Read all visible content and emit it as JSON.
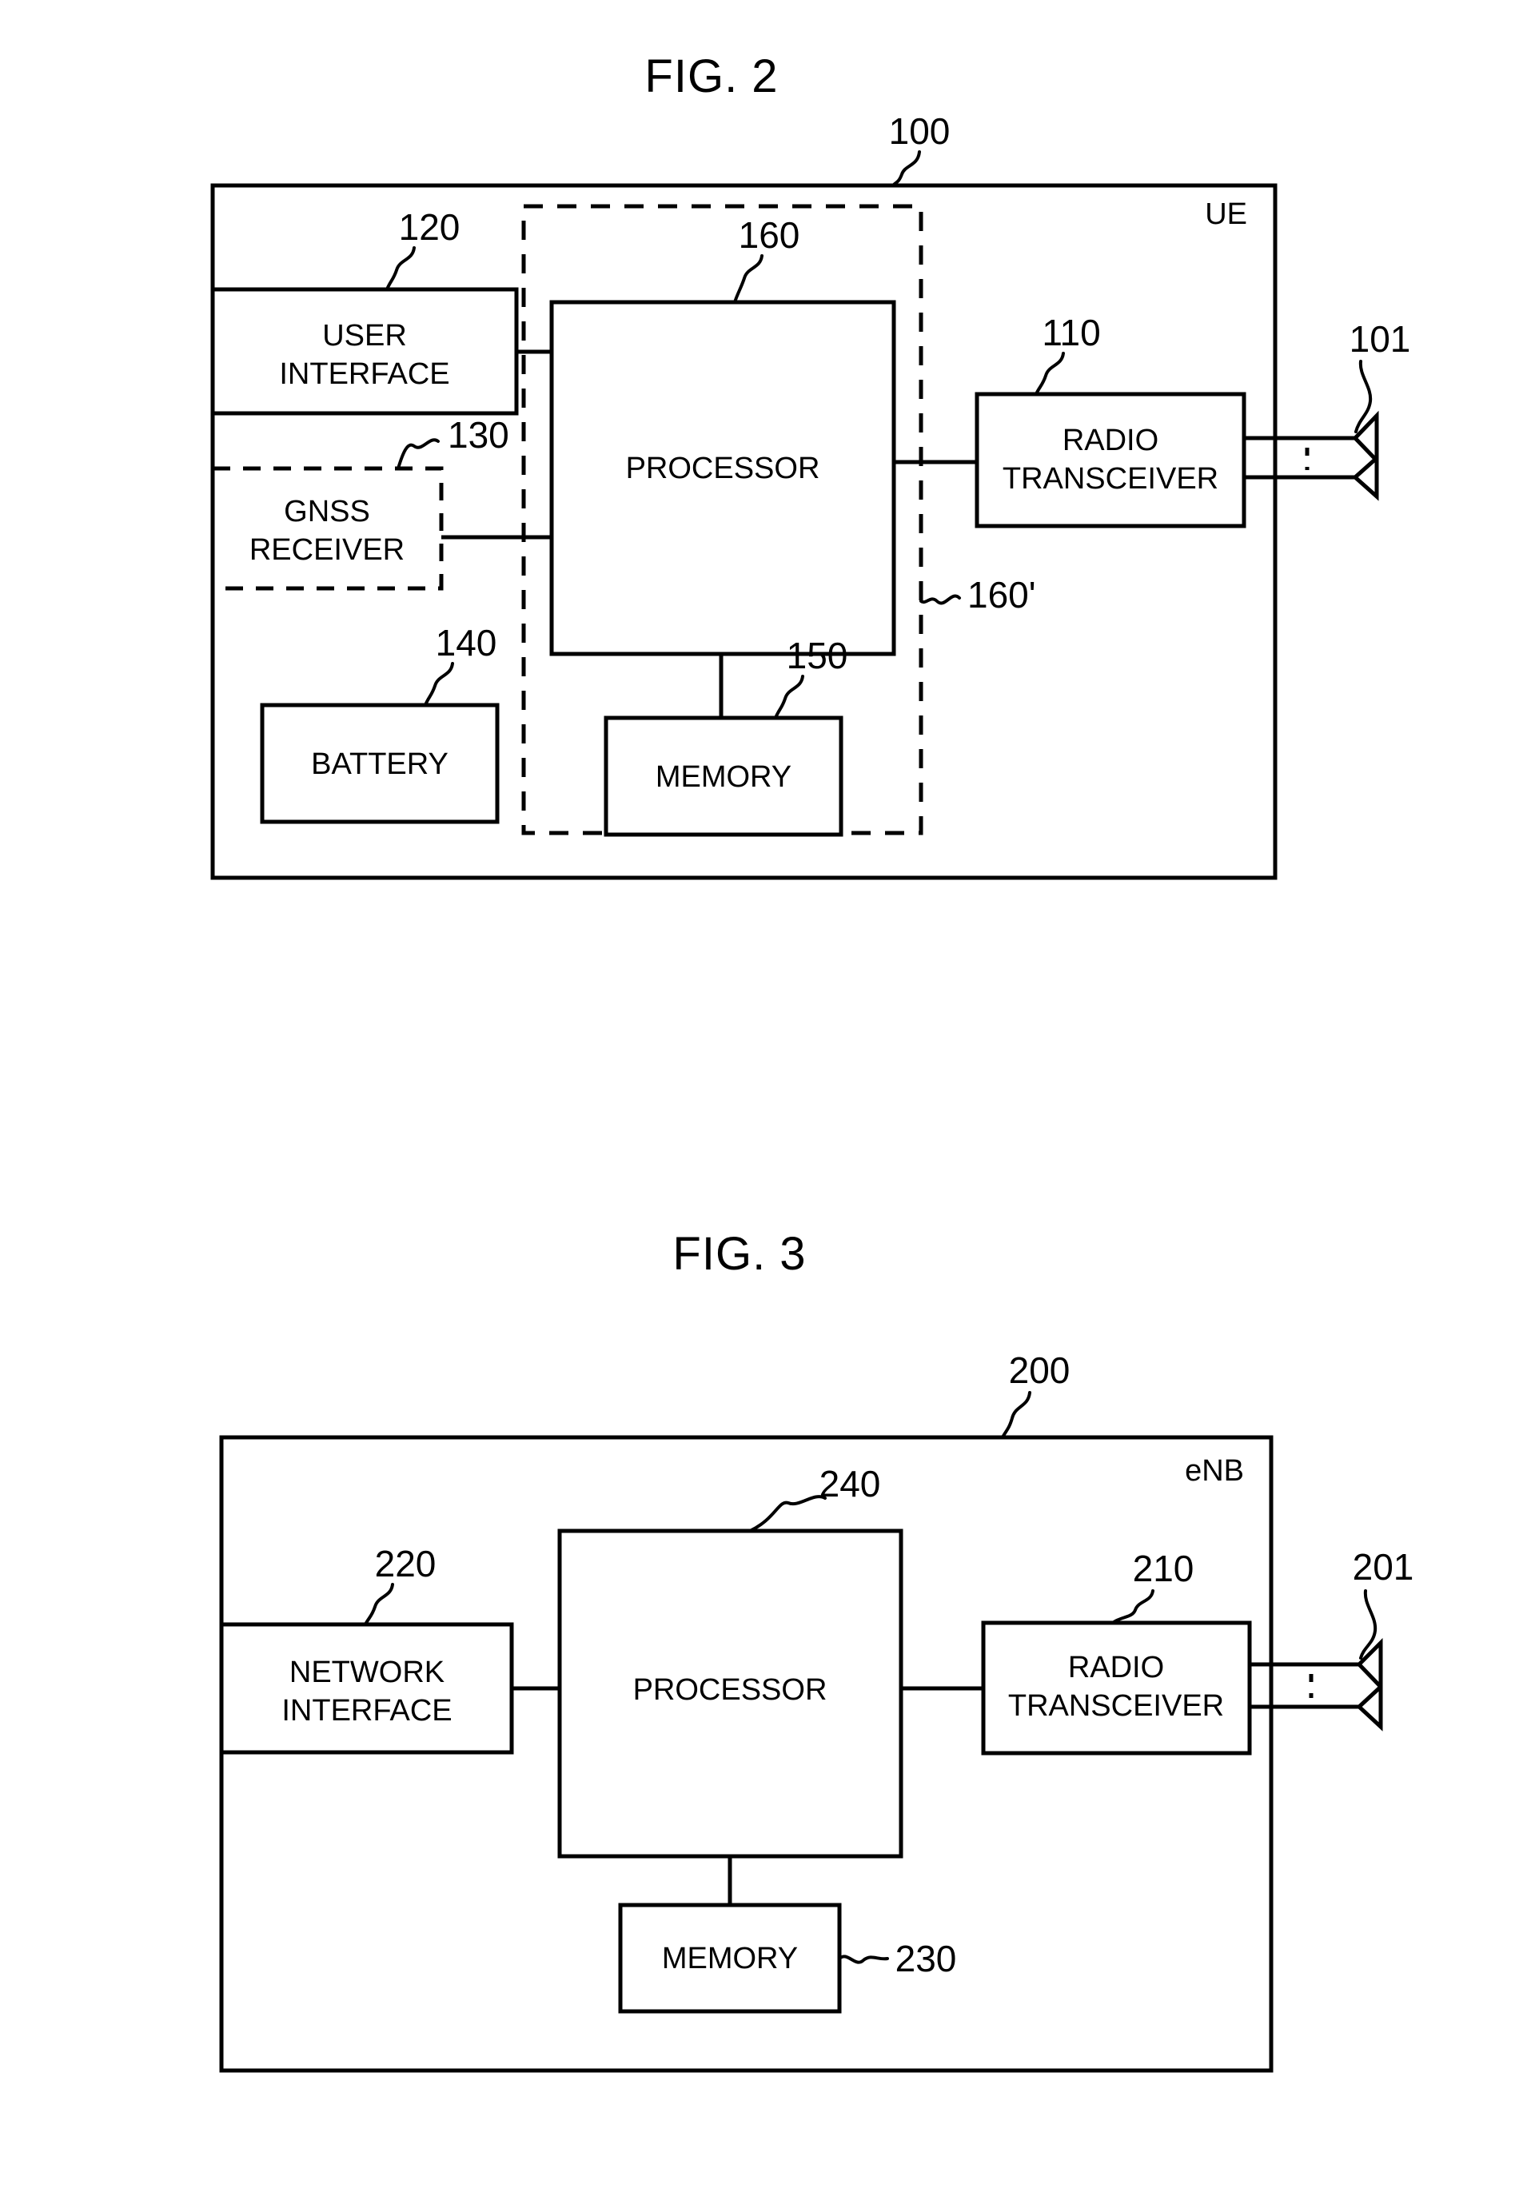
{
  "document": {
    "type": "patent-drawing-sheet",
    "figures": [
      {
        "id": "fig2",
        "title": "FIG. 2",
        "device_label": "UE",
        "device_ref": "100",
        "antenna_ref": "101",
        "dashed_group_ref": "160'",
        "blocks": [
          {
            "key": "user_interface",
            "label_line1": "USER",
            "label_line2": "INTERFACE",
            "ref": "120",
            "style": "solid"
          },
          {
            "key": "gnss_receiver",
            "label_line1": "GNSS",
            "label_line2": "RECEIVER",
            "ref": "130",
            "style": "dashed"
          },
          {
            "key": "battery",
            "label_line1": "BATTERY",
            "label_line2": "",
            "ref": "140",
            "style": "solid"
          },
          {
            "key": "processor",
            "label_line1": "PROCESSOR",
            "label_line2": "",
            "ref": "160",
            "style": "solid"
          },
          {
            "key": "memory",
            "label_line1": "MEMORY",
            "label_line2": "",
            "ref": "150",
            "style": "solid"
          },
          {
            "key": "radio_transceiver",
            "label_line1": "RADIO",
            "label_line2": "TRANSCEIVER",
            "ref": "110",
            "style": "solid"
          }
        ]
      },
      {
        "id": "fig3",
        "title": "FIG. 3",
        "device_label": "eNB",
        "device_ref": "200",
        "antenna_ref": "201",
        "blocks": [
          {
            "key": "network_interface",
            "label_line1": "NETWORK",
            "label_line2": "INTERFACE",
            "ref": "220",
            "style": "solid"
          },
          {
            "key": "processor",
            "label_line1": "PROCESSOR",
            "label_line2": "",
            "ref": "240",
            "style": "solid"
          },
          {
            "key": "memory",
            "label_line1": "MEMORY",
            "label_line2": "",
            "ref": "230",
            "style": "solid"
          },
          {
            "key": "radio_transceiver",
            "label_line1": "RADIO",
            "label_line2": "TRANSCEIVER",
            "ref": "210",
            "style": "solid"
          }
        ]
      }
    ]
  },
  "fig2": {
    "title": "FIG. 2",
    "ue_label": "UE",
    "ref_100": "100",
    "ref_101": "101",
    "ref_110": "110",
    "ref_120": "120",
    "ref_130": "130",
    "ref_140": "140",
    "ref_150": "150",
    "ref_160": "160",
    "ref_160p": "160'",
    "user_interface_l1": "USER",
    "user_interface_l2": "INTERFACE",
    "gnss_l1": "GNSS",
    "gnss_l2": "RECEIVER",
    "battery": "BATTERY",
    "processor": "PROCESSOR",
    "memory": "MEMORY",
    "radio_l1": "RADIO",
    "radio_l2": "TRANSCEIVER"
  },
  "fig3": {
    "title": "FIG. 3",
    "enb_label": "eNB",
    "ref_200": "200",
    "ref_201": "201",
    "ref_210": "210",
    "ref_220": "220",
    "ref_230": "230",
    "ref_240": "240",
    "network_interface_l1": "NETWORK",
    "network_interface_l2": "INTERFACE",
    "processor": "PROCESSOR",
    "memory": "MEMORY",
    "radio_l1": "RADIO",
    "radio_l2": "TRANSCEIVER"
  },
  "colors": {
    "ink": "#000000",
    "paper": "#ffffff"
  }
}
